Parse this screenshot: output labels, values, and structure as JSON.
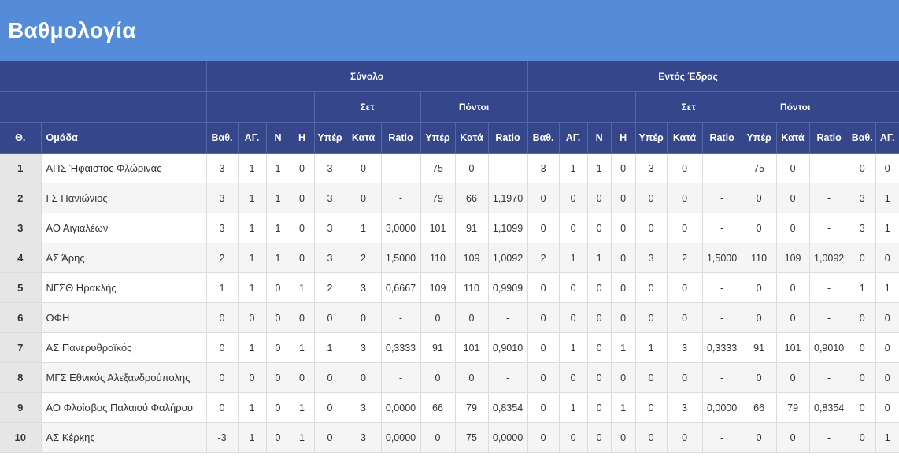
{
  "page": {
    "title": "Βαθμολογία"
  },
  "groups": {
    "total": "Σύνολο",
    "home": "Εντός Έδρας",
    "sets": "Σετ",
    "points": "Πόντοι"
  },
  "columns": {
    "pos": "Θ.",
    "team": "Ομάδα",
    "pts": "Βαθ.",
    "played": "ΑΓ.",
    "wins": "Ν",
    "losses": "Η",
    "for": "Υπέρ",
    "against": "Κατά",
    "ratio": "Ratio",
    "pts_cut": "Βαθ.",
    "played_cut": "ΑΓ."
  },
  "rows": [
    {
      "pos": "1",
      "team": "ΑΠΣ Ήφαιστος Φλώρινας",
      "total": [
        "3",
        "1",
        "1",
        "0",
        "3",
        "0",
        "-",
        "75",
        "0",
        "-"
      ],
      "home": [
        "3",
        "1",
        "1",
        "0",
        "3",
        "0",
        "-",
        "75",
        "0",
        "-"
      ],
      "away": [
        "0",
        "0"
      ]
    },
    {
      "pos": "2",
      "team": "ΓΣ Πανιώνιος",
      "total": [
        "3",
        "1",
        "1",
        "0",
        "3",
        "0",
        "-",
        "79",
        "66",
        "1,1970"
      ],
      "home": [
        "0",
        "0",
        "0",
        "0",
        "0",
        "0",
        "-",
        "0",
        "0",
        "-"
      ],
      "away": [
        "3",
        "1"
      ]
    },
    {
      "pos": "3",
      "team": "ΑΟ Αιγιαλέων",
      "total": [
        "3",
        "1",
        "1",
        "0",
        "3",
        "1",
        "3,0000",
        "101",
        "91",
        "1,1099"
      ],
      "home": [
        "0",
        "0",
        "0",
        "0",
        "0",
        "0",
        "-",
        "0",
        "0",
        "-"
      ],
      "away": [
        "3",
        "1"
      ]
    },
    {
      "pos": "4",
      "team": "ΑΣ Άρης",
      "total": [
        "2",
        "1",
        "1",
        "0",
        "3",
        "2",
        "1,5000",
        "110",
        "109",
        "1,0092"
      ],
      "home": [
        "2",
        "1",
        "1",
        "0",
        "3",
        "2",
        "1,5000",
        "110",
        "109",
        "1,0092"
      ],
      "away": [
        "0",
        "0"
      ]
    },
    {
      "pos": "5",
      "team": "ΝΓΣΘ Ηρακλής",
      "total": [
        "1",
        "1",
        "0",
        "1",
        "2",
        "3",
        "0,6667",
        "109",
        "110",
        "0,9909"
      ],
      "home": [
        "0",
        "0",
        "0",
        "0",
        "0",
        "0",
        "-",
        "0",
        "0",
        "-"
      ],
      "away": [
        "1",
        "1"
      ]
    },
    {
      "pos": "6",
      "team": "ΟΦΗ",
      "total": [
        "0",
        "0",
        "0",
        "0",
        "0",
        "0",
        "-",
        "0",
        "0",
        "-"
      ],
      "home": [
        "0",
        "0",
        "0",
        "0",
        "0",
        "0",
        "-",
        "0",
        "0",
        "-"
      ],
      "away": [
        "0",
        "0"
      ]
    },
    {
      "pos": "7",
      "team": "ΑΣ Πανερυθραϊκός",
      "total": [
        "0",
        "1",
        "0",
        "1",
        "1",
        "3",
        "0,3333",
        "91",
        "101",
        "0,9010"
      ],
      "home": [
        "0",
        "1",
        "0",
        "1",
        "1",
        "3",
        "0,3333",
        "91",
        "101",
        "0,9010"
      ],
      "away": [
        "0",
        "0"
      ]
    },
    {
      "pos": "8",
      "team": "ΜΓΣ Εθνικός Αλεξανδρούπολης",
      "total": [
        "0",
        "0",
        "0",
        "0",
        "0",
        "0",
        "-",
        "0",
        "0",
        "-"
      ],
      "home": [
        "0",
        "0",
        "0",
        "0",
        "0",
        "0",
        "-",
        "0",
        "0",
        "-"
      ],
      "away": [
        "0",
        "0"
      ]
    },
    {
      "pos": "9",
      "team": "ΑΟ Φλοίσβος Παλαιού Φαλήρου",
      "total": [
        "0",
        "1",
        "0",
        "1",
        "0",
        "3",
        "0,0000",
        "66",
        "79",
        "0,8354"
      ],
      "home": [
        "0",
        "1",
        "0",
        "1",
        "0",
        "3",
        "0,0000",
        "66",
        "79",
        "0,8354"
      ],
      "away": [
        "0",
        "0"
      ]
    },
    {
      "pos": "10",
      "team": "ΑΣ Κέρκης",
      "total": [
        "-3",
        "1",
        "0",
        "1",
        "0",
        "3",
        "0,0000",
        "0",
        "75",
        "0,0000"
      ],
      "home": [
        "0",
        "0",
        "0",
        "0",
        "0",
        "0",
        "-",
        "0",
        "0",
        "-"
      ],
      "away": [
        "0",
        "1"
      ]
    }
  ]
}
